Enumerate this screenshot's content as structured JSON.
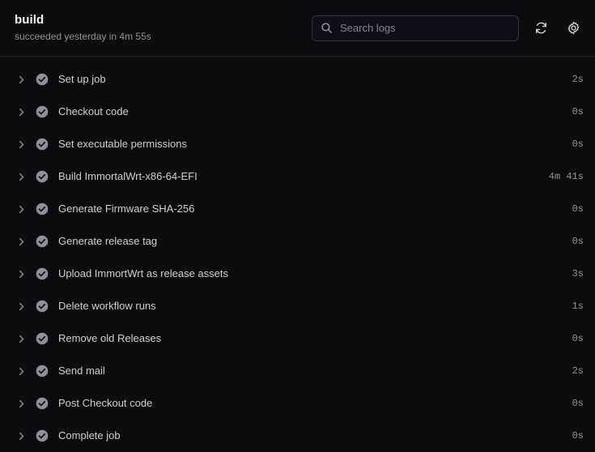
{
  "header": {
    "job_title": "build",
    "job_status_line": "succeeded yesterday in 4m 55s",
    "search": {
      "placeholder": "Search logs",
      "value": "",
      "icon": "search-icon"
    },
    "actions": [
      {
        "name": "refresh-button",
        "icon": "sync-refresh-icon",
        "label": ""
      },
      {
        "name": "settings-button",
        "icon": "gear-icon",
        "label": ""
      }
    ]
  },
  "colors": {
    "background": "#0a0c10",
    "surface": "#0d1117",
    "border": "#30363d",
    "divider": "#21262d",
    "text_primary": "#f0f6fc",
    "text_secondary": "#c9d1d9",
    "text_muted": "#8b949e",
    "success_icon": "#8b949e"
  },
  "steps": [
    {
      "label": "Set up job",
      "duration": "2s",
      "status": "success",
      "expanded": false
    },
    {
      "label": "Checkout code",
      "duration": "0s",
      "status": "success",
      "expanded": false
    },
    {
      "label": "Set executable permissions",
      "duration": "0s",
      "status": "success",
      "expanded": false
    },
    {
      "label": "Build ImmortalWrt-x86-64-EFI",
      "duration": "4m 41s",
      "status": "success",
      "expanded": false
    },
    {
      "label": "Generate Firmware SHA-256",
      "duration": "0s",
      "status": "success",
      "expanded": false
    },
    {
      "label": "Generate release tag",
      "duration": "0s",
      "status": "success",
      "expanded": false
    },
    {
      "label": "Upload ImmortWrt as release assets",
      "duration": "3s",
      "status": "success",
      "expanded": false
    },
    {
      "label": "Delete workflow runs",
      "duration": "1s",
      "status": "success",
      "expanded": false
    },
    {
      "label": "Remove old Releases",
      "duration": "0s",
      "status": "success",
      "expanded": false
    },
    {
      "label": "Send mail",
      "duration": "2s",
      "status": "success",
      "expanded": false
    },
    {
      "label": "Post Checkout code",
      "duration": "0s",
      "status": "success",
      "expanded": false
    },
    {
      "label": "Complete job",
      "duration": "0s",
      "status": "success",
      "expanded": false
    }
  ]
}
